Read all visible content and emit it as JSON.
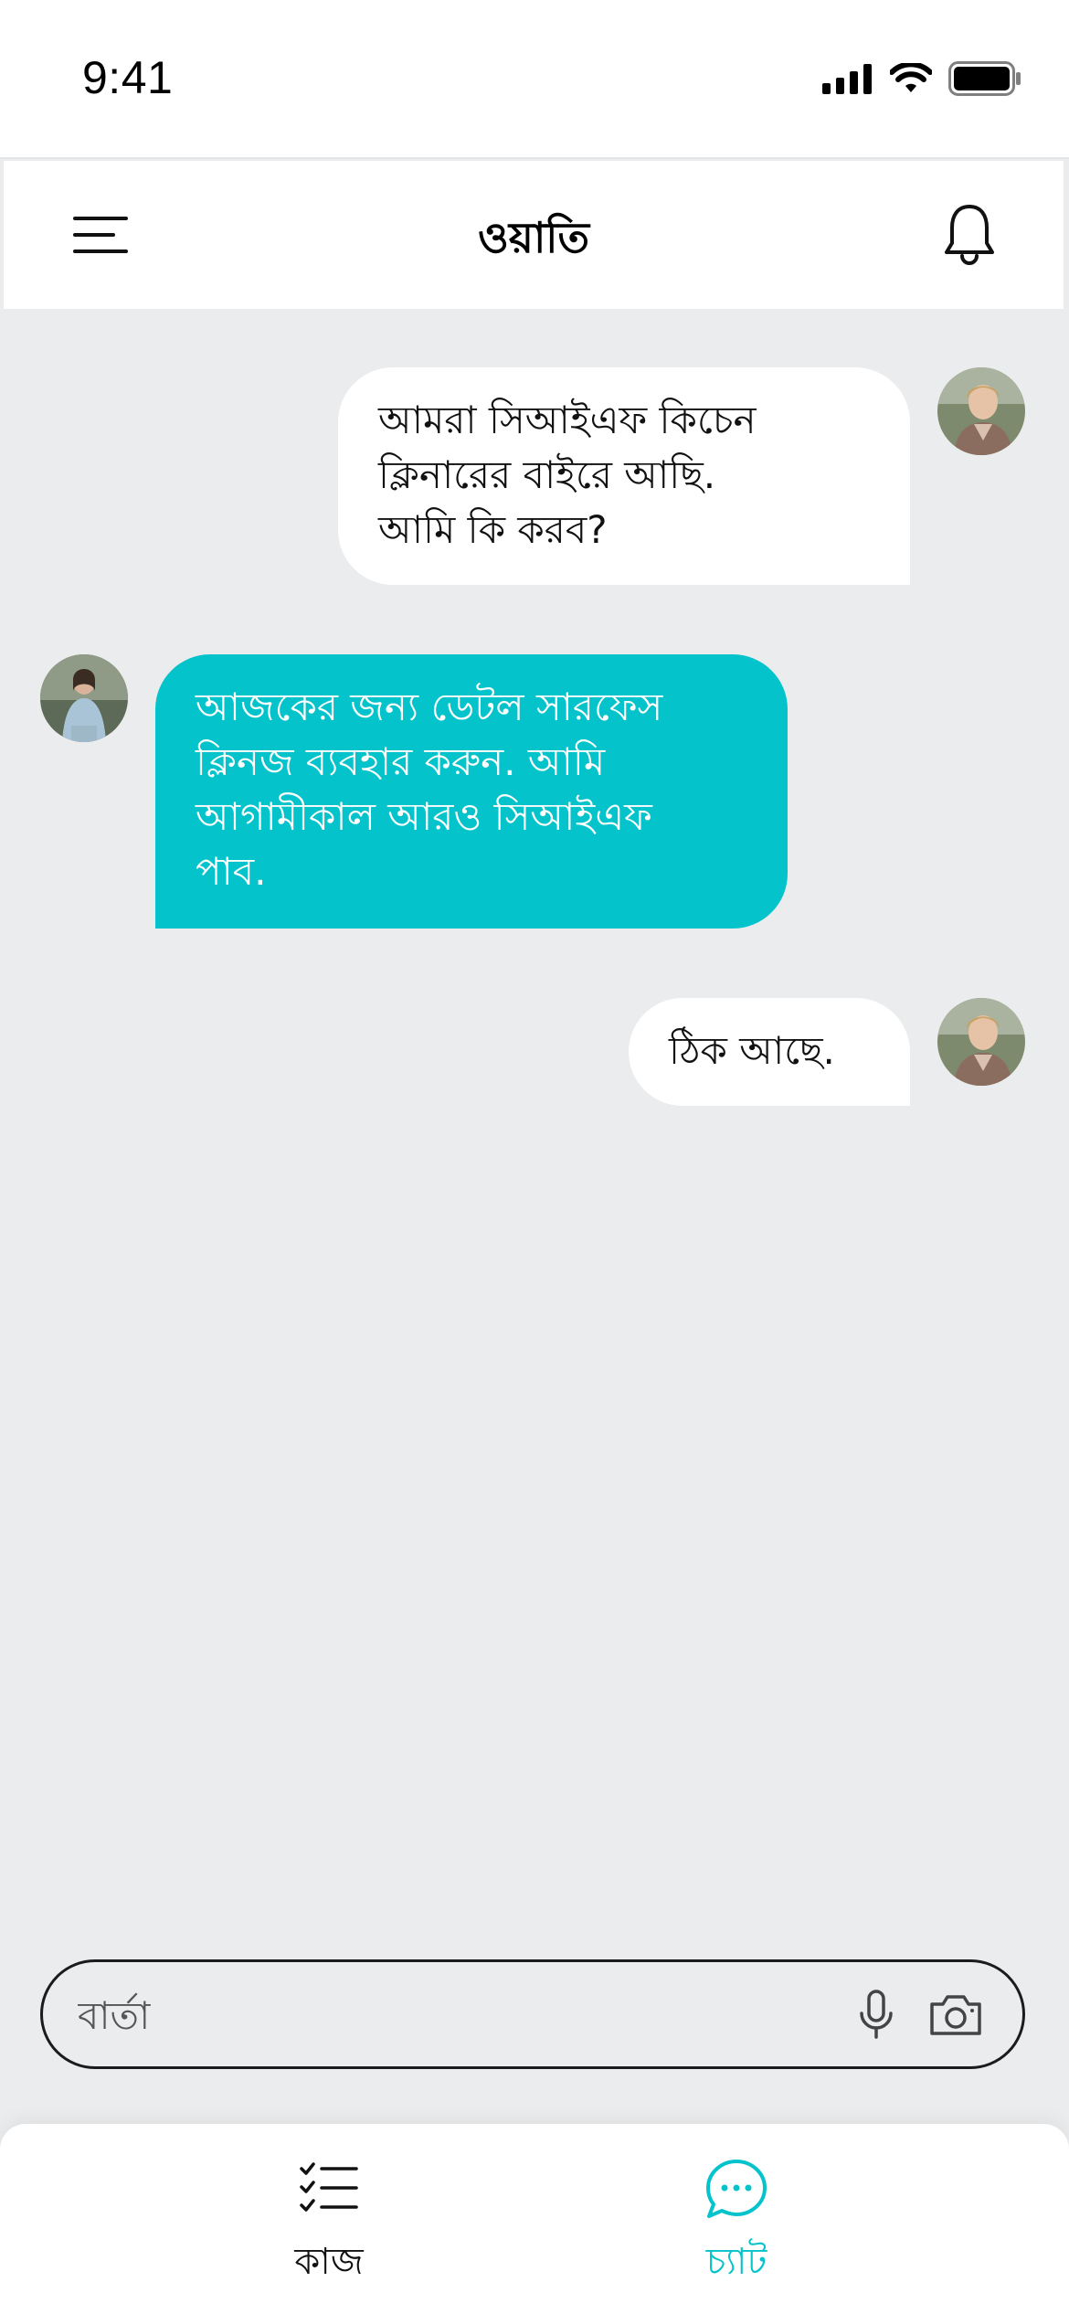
{
  "status_bar": {
    "time": "9:41"
  },
  "header": {
    "title": "ওয়াতি"
  },
  "messages": [
    {
      "direction": "outgoing",
      "text": "আমরা সিআইএফ কিচেন\nক্লিনারের বাইরে আছি.\nআমি কি করব?"
    },
    {
      "direction": "incoming",
      "text": "আজকের জন্য ডেটল সারফেস\nক্লিনজ ব্যবহার করুন. আমি\nআগামীকাল আরও সিআইএফ\nপাব."
    },
    {
      "direction": "outgoing",
      "text": "ঠিক আছে."
    }
  ],
  "composer": {
    "placeholder": "বার্তা"
  },
  "tabs": [
    {
      "label": "কাজ",
      "icon": "tasks-checklist-icon",
      "active": false
    },
    {
      "label": "চ্যাট",
      "icon": "chat-bubble-icon",
      "active": true
    }
  ],
  "colors": {
    "accent": "#05c3cb",
    "background": "#ebeced",
    "bubble_outgoing": "#ffffff",
    "text": "#111111"
  }
}
